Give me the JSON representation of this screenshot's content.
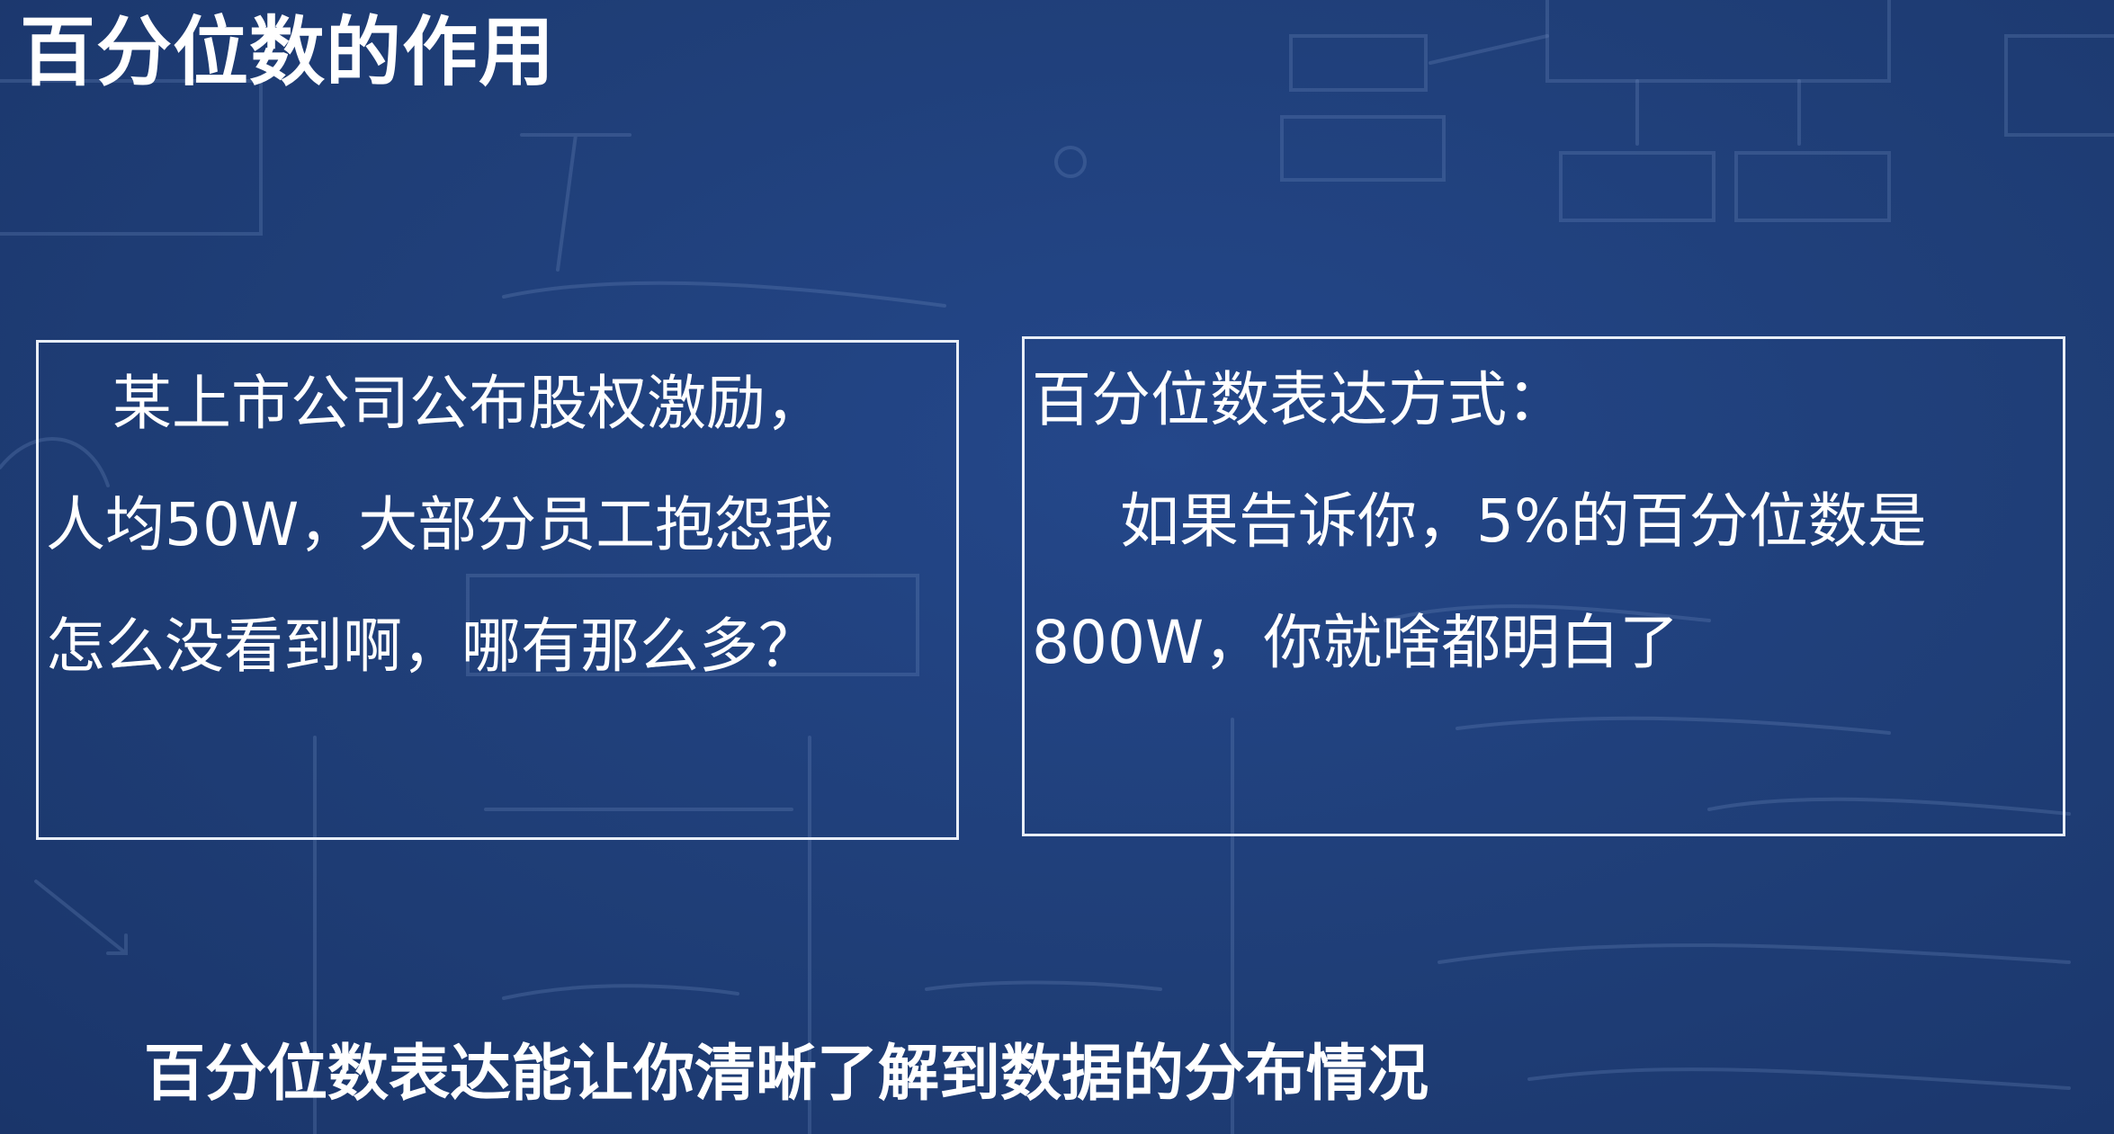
{
  "slide": {
    "title": "百分位数的作用",
    "left_box": {
      "lines": [
        "某上市公司公布股权激励，",
        "人均50W，大部分员工抱怨我",
        "怎么没看到啊，哪有那么多？"
      ]
    },
    "right_box": {
      "lines": [
        "百分位数表达方式：",
        "如果告诉你，5%的百分位数是",
        "800W，你就啥都明白了"
      ]
    },
    "footer": "百分位数表达能让你清晰了解到数据的分布情况"
  },
  "colors": {
    "background": "#1f3e77",
    "text": "#ffffff",
    "border": "#e8eef8",
    "sketch": "#6f8bbf"
  }
}
